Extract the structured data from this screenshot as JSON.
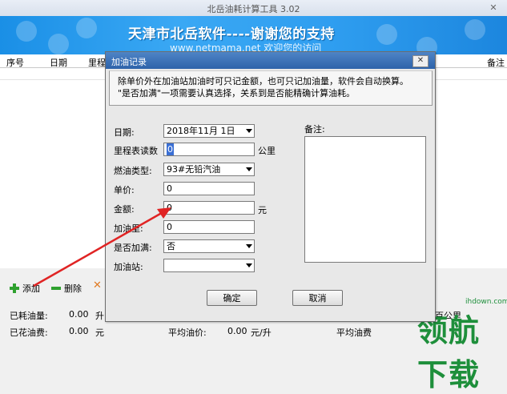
{
  "main": {
    "title": "北岳油耗计算工具 3.02",
    "close_glyph": "✕",
    "banner": {
      "line1": "天津市北岳软件----谢谢您的支持",
      "line2": "www.netmama.net 欢迎您的访问"
    },
    "columns": [
      "序号",
      "日期",
      "里程",
      "备注"
    ],
    "toolbar": {
      "add": "添加",
      "delete": "删除"
    },
    "stats": {
      "fuel_used_label": "已耗油量:",
      "fuel_used_value": "0.00",
      "fuel_used_unit": "升",
      "spent_label": "已花油费:",
      "spent_value": "0.00",
      "spent_unit": "元",
      "avg_price_label": "平均油价:",
      "avg_price_value": "0.00",
      "avg_price_unit": "元/升",
      "avg_fee_label": "平均油费",
      "per_100km_suffix": "百公里"
    }
  },
  "watermark": {
    "text": "领航下载",
    "url": "ihdown.com"
  },
  "dialog": {
    "title": "加油记录",
    "close_glyph": "✕",
    "notice_line1": "除单价外在加油站加油时可只记金额，也可只记加油量，软件会自动换算。",
    "notice_line2": "\"是否加满\"一项需要认真选择，关系到是否能精确计算油耗。",
    "labels": {
      "date": "日期:",
      "odometer": "里程表读数",
      "fuel_type": "燃油类型:",
      "unit_price": "单价:",
      "amount": "金额:",
      "fuel_volume": "加油里:",
      "full_tank": "是否加满:",
      "station": "加油站:",
      "notes": "备注:"
    },
    "units": {
      "odometer": "公里",
      "amount": "元"
    },
    "values": {
      "date": "2018年11月 1日",
      "odometer": "0",
      "fuel_type": "93#无铅汽油",
      "unit_price": "0",
      "amount": "0",
      "fuel_volume": "0",
      "full_tank": "否",
      "station": "",
      "notes": ""
    },
    "buttons": {
      "ok": "确定",
      "cancel": "取消"
    }
  },
  "colors": {
    "banner": "#2f9ef0",
    "dialog_titlebar": "#3a6fb5",
    "arrow": "#e02424",
    "watermark": "#1e8f3b"
  }
}
